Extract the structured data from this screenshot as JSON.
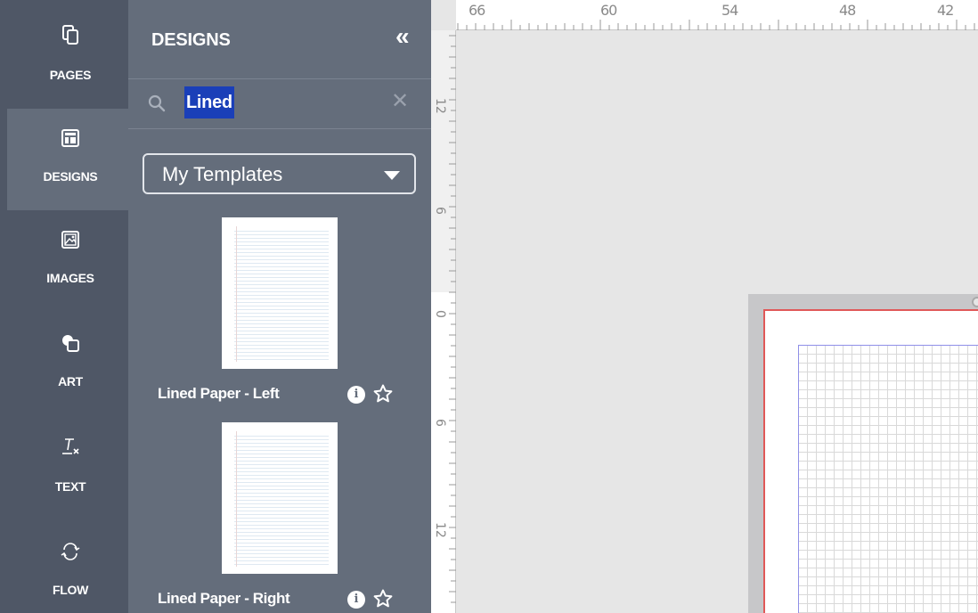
{
  "rail": {
    "items": [
      {
        "label": "PAGES",
        "icon": "pages-icon"
      },
      {
        "label": "DESIGNS",
        "icon": "designs-icon",
        "active": true
      },
      {
        "label": "IMAGES",
        "icon": "images-icon"
      },
      {
        "label": "ART",
        "icon": "art-icon"
      },
      {
        "label": "TEXT",
        "icon": "text-icon"
      },
      {
        "label": "FLOW",
        "icon": "flow-icon"
      }
    ]
  },
  "panel": {
    "title": "DESIGNS",
    "collapse_glyph": "«",
    "search": {
      "value": "Lined",
      "clear_glyph": "✕"
    },
    "template_filter": {
      "selected": "My Templates"
    },
    "results": [
      {
        "name": "Lined Paper - Left"
      },
      {
        "name": "Lined Paper - Right"
      }
    ]
  },
  "canvas": {
    "ruler_top_labels": [
      "66",
      "60",
      "54",
      "48",
      "42"
    ],
    "ruler_left_labels": [
      "12",
      "6",
      "0",
      "6",
      "12"
    ]
  },
  "colors": {
    "rail_bg": "#4f5766",
    "panel_bg": "#646d7b",
    "search_highlight": "#1a3fb8",
    "page_border": "#e05858",
    "grid_margin": "#8f8fe8"
  }
}
